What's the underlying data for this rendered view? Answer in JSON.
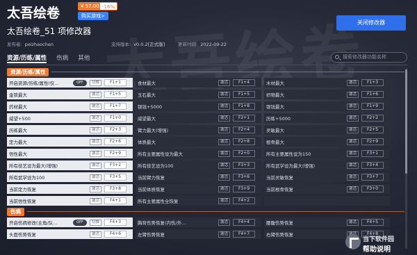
{
  "header": {
    "game_title": "太吾绘卷",
    "price": "¥ 57.00",
    "discount": "-16%",
    "buy_label": "购买游戏>",
    "subtitle": "太吾绘卷_51 项修改器",
    "publisher_label": "发布者:",
    "publisher": "peizhaochen",
    "version_label": "支持版本:",
    "version": "v0.0.2[正式版]",
    "updated_label": "更新时间:",
    "updated": "2022-09-22",
    "close_button": "关闭修改器"
  },
  "tabs": [
    {
      "label": "资源/历练/属性",
      "active": true
    },
    {
      "label": "伤病",
      "active": false
    },
    {
      "label": "其他",
      "active": false
    }
  ],
  "search": {
    "placeholder": "搜索修改器功能名称"
  },
  "sections": [
    {
      "label": "资源/历练/属性",
      "rows": [
        [
          {
            "name": "开启资源/历练/属性(仅...",
            "toggle": "OFF",
            "action": "切换",
            "key": "F1+1"
          },
          {
            "name": "食材最大",
            "action": "激活",
            "key": "F1+4"
          },
          {
            "name": "木材最大",
            "action": "激活",
            "key": "F1+3"
          }
        ],
        [
          {
            "name": "金铁最大",
            "action": "激活",
            "key": "F1+5"
          },
          {
            "name": "玉石最大",
            "action": "激活",
            "key": "F1+5"
          },
          {
            "name": "织物最大",
            "action": "激活",
            "key": "F1+6"
          }
        ],
        [
          {
            "name": "药材最大",
            "action": "激活",
            "key": "F1+7"
          },
          {
            "name": "银钱+5000",
            "action": "激活",
            "key": "F1+8"
          },
          {
            "name": "银钱最大",
            "action": "激活",
            "key": "F1+9"
          }
        ],
        [
          {
            "name": "威望+500",
            "action": "激活",
            "key": "F1+0"
          },
          {
            "name": "威望最大",
            "action": "激活",
            "key": "F2+1"
          },
          {
            "name": "历练+5000",
            "action": "激活",
            "key": "F2+2"
          }
        ],
        [
          {
            "name": "历练最大",
            "action": "激活",
            "key": "F2+3"
          },
          {
            "name": "臂力最大(增强)",
            "action": "激活",
            "key": "F2+4"
          },
          {
            "name": "灵敏最大",
            "action": "激活",
            "key": "F2+5"
          }
        ],
        [
          {
            "name": "定力最大",
            "action": "激活",
            "key": "F2+6"
          },
          {
            "name": "体质最大",
            "action": "激活",
            "key": "F2+8"
          },
          {
            "name": "根骨最大",
            "action": "激活",
            "key": "F2+9"
          }
        ],
        [
          {
            "name": "悟性最大",
            "action": "激活",
            "key": "F2+9"
          },
          {
            "name": "所有主要属性设为最大",
            "action": "激活",
            "key": "F2+0"
          },
          {
            "name": "所有主要属性设为150",
            "action": "激活",
            "key": "F3+1"
          }
        ],
        [
          {
            "name": "所有技艺设为最大(增强)",
            "action": "激活",
            "key": "F3+2"
          },
          {
            "name": "所有技艺设为100",
            "action": "激活",
            "key": "F3+3"
          },
          {
            "name": "所有武学设为最大(增强)",
            "action": "激活",
            "key": "F3+4"
          }
        ],
        [
          {
            "name": "所有武学设为100",
            "action": "激活",
            "key": "F3+5"
          },
          {
            "name": "当前臂力恢复",
            "action": "激活",
            "key": "F3+6"
          },
          {
            "name": "当前灵敏恢复",
            "action": "激活",
            "key": "F3+7"
          }
        ],
        [
          {
            "name": "当前定力恢复",
            "action": "激活",
            "key": "F3+8"
          },
          {
            "name": "当前体质恢复",
            "action": "激活",
            "key": "F3+9"
          },
          {
            "name": "当前根骨恢复",
            "action": "激活",
            "key": "F3+0"
          }
        ],
        [
          {
            "name": "当前悟性恢复",
            "action": "激活",
            "key": "F4+1"
          },
          {
            "name": "所有主要属性全恢复",
            "action": "激活",
            "key": "F4+2"
          },
          {
            "name": "",
            "action": "",
            "key": "",
            "empty": true
          }
        ]
      ]
    },
    {
      "label": "伤病",
      "rows": [
        [
          {
            "name": "开启伤病修改(主角/队...",
            "toggle": "OFF",
            "action": "切换",
            "key": "F4+3"
          },
          {
            "name": "胸背伤势恢复(内伤/外...",
            "action": "激活",
            "key": "F4+4"
          },
          {
            "name": "腰腹伤势恢复",
            "action": "激活",
            "key": "F4+5"
          }
        ],
        [
          {
            "name": "头面伤势恢复",
            "action": "激活",
            "key": "F4+6"
          },
          {
            "name": "左臂伤势恢复",
            "action": "激活",
            "key": "F4+7"
          },
          {
            "name": "右臂伤势恢复",
            "action": "激活",
            "key": "F4+8"
          }
        ]
      ]
    }
  ],
  "watermark": {
    "line1": "当下软件园",
    "line2": "帮助说明"
  }
}
